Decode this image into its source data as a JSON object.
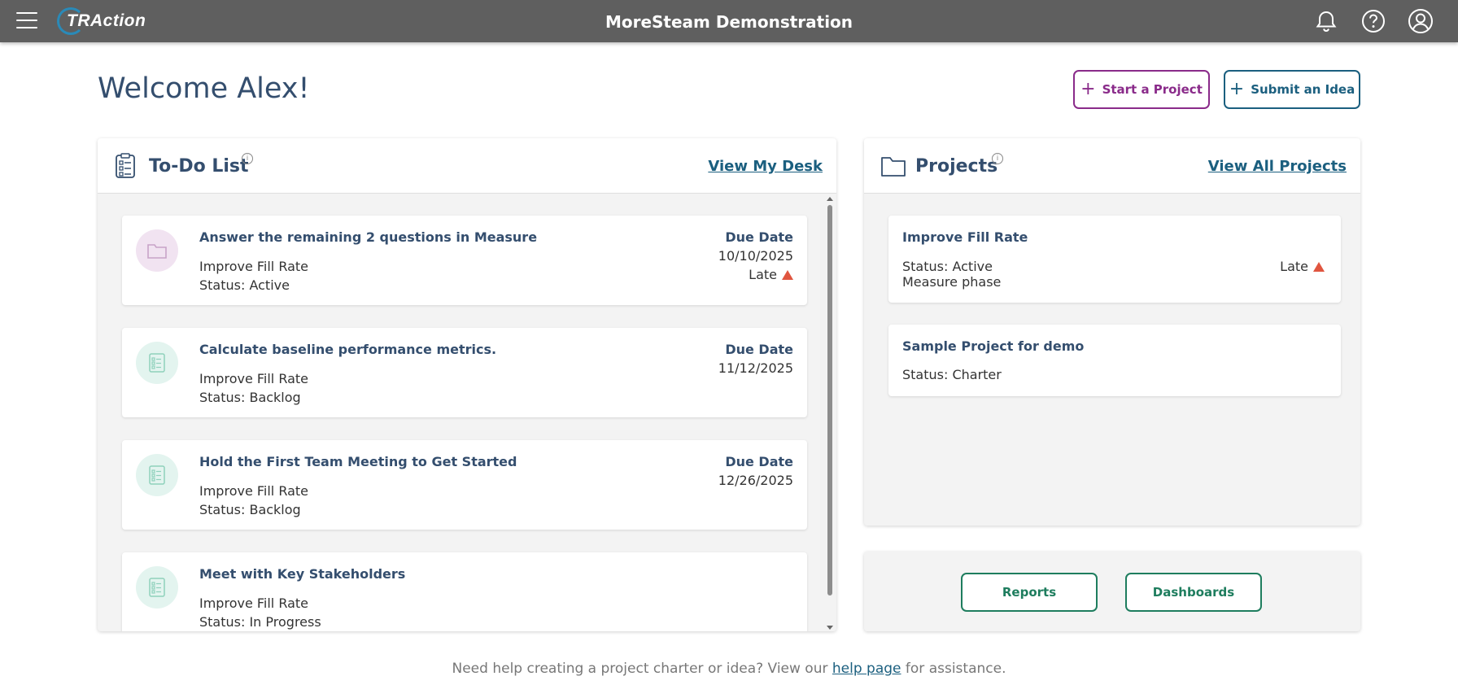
{
  "header": {
    "logo_text": "TRAction",
    "app_title": "MoreSteam Demonstration"
  },
  "welcome": "Welcome Alex!",
  "actions": {
    "start_project": "Start a Project",
    "submit_idea": "Submit an Idea"
  },
  "todo": {
    "title": "To-Do List",
    "link": "View My Desk",
    "items": [
      {
        "title": "Answer the remaining 2 questions in Measure",
        "project": "Improve Fill Rate",
        "status": "Status:  Active",
        "due_label": "Due Date",
        "due_date": "10/10/2025",
        "late": "Late",
        "icon": "folder-icon"
      },
      {
        "title": "Calculate baseline performance metrics.",
        "project": "Improve Fill Rate",
        "status": "Status:  Backlog",
        "due_label": "Due Date",
        "due_date": "11/12/2025",
        "icon": "checklist-icon"
      },
      {
        "title": "Hold the First Team Meeting to Get Started",
        "project": "Improve Fill Rate",
        "status": "Status:  Backlog",
        "due_label": "Due Date",
        "due_date": "12/26/2025",
        "icon": "checklist-icon"
      },
      {
        "title": "Meet with Key Stakeholders",
        "project": "Improve Fill Rate",
        "status": "Status:  In Progress",
        "icon": "checklist-icon"
      }
    ]
  },
  "projects": {
    "title": "Projects",
    "link": "View All Projects",
    "items": [
      {
        "title": "Improve Fill Rate",
        "status": "Status:  Active",
        "phase": "Measure phase",
        "late": "Late"
      },
      {
        "title": "Sample Project for demo",
        "status": "Status:  Charter"
      }
    ]
  },
  "reports": {
    "reports_label": "Reports",
    "dashboards_label": "Dashboards"
  },
  "footer": {
    "before": "Need help creating a project charter or idea? View our ",
    "link": "help page",
    "after": " for assistance."
  },
  "colors": {
    "topbar": "#5f5f5f",
    "heading": "#344e6e",
    "start_button": "#8a2b8a",
    "idea_button": "#1b5f7f",
    "green_button": "#1e7d5e",
    "late_warning": "#e0553f"
  }
}
